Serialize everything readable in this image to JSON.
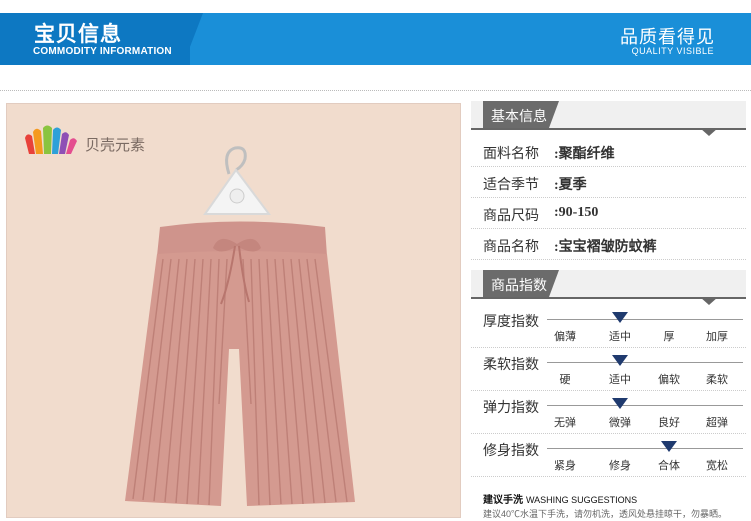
{
  "header": {
    "title": "宝贝信息",
    "subtitle": "COMMODITY INFORMATION",
    "right_title": "品质看得见",
    "right_subtitle": "QUALITY VISIBLE",
    "colors": {
      "bar": "#1a8fd8",
      "tab": "#0d78c2"
    }
  },
  "photo": {
    "brand": "贝壳元素",
    "product": "pink pleated wide-leg pants on hanger",
    "background": "#f1dccd"
  },
  "basic_info": {
    "heading": "基本信息",
    "rows": [
      {
        "key": "面料名称",
        "value": "聚酯纤维"
      },
      {
        "key": "适合季节",
        "value": "夏季"
      },
      {
        "key": "商品尺码",
        "value": "90-150"
      },
      {
        "key": "商品名称",
        "value": "宝宝褶皱防蚊裤"
      }
    ]
  },
  "indices": {
    "heading": "商品指数",
    "rows": [
      {
        "label": "厚度指数",
        "options": [
          "偏薄",
          "适中",
          "厚",
          "加厚"
        ],
        "selected": 1
      },
      {
        "label": "柔软指数",
        "options": [
          "硬",
          "适中",
          "偏软",
          "柔软"
        ],
        "selected": 1
      },
      {
        "label": "弹力指数",
        "options": [
          "无弹",
          "微弹",
          "良好",
          "超弹"
        ],
        "selected": 1
      },
      {
        "label": "修身指数",
        "options": [
          "紧身",
          "修身",
          "合体",
          "宽松"
        ],
        "selected": 2
      }
    ]
  },
  "washing": {
    "title": "建议手洗",
    "title_en": "WASHING SUGGESTIONS",
    "text": "建议40℃水温下手洗，请勿机洗，透风处悬挂晾干，勿暴晒。"
  }
}
